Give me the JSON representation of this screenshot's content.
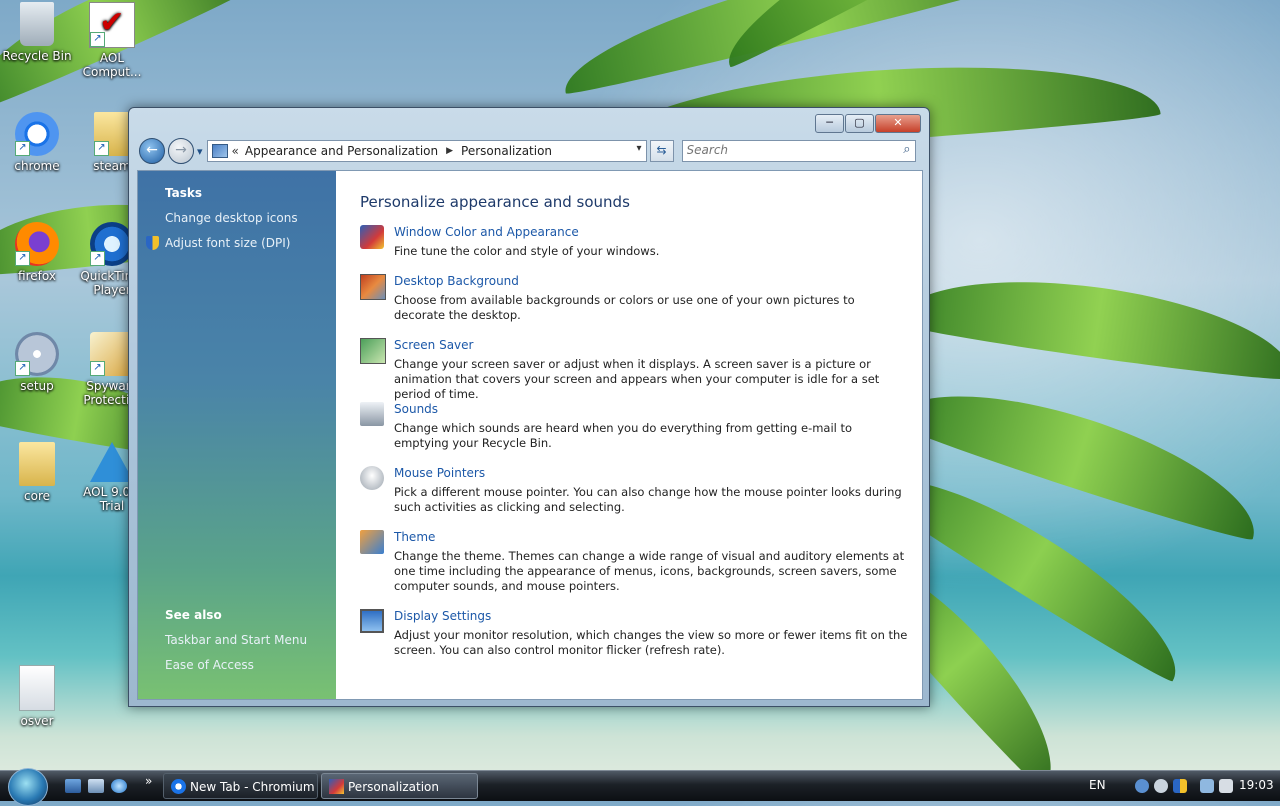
{
  "desktop": {
    "icons": [
      {
        "label": "Recycle Bin"
      },
      {
        "label": "AOL Comput..."
      },
      {
        "label": "chrome"
      },
      {
        "label": "steam"
      },
      {
        "label": "firefox"
      },
      {
        "label": "QuickTime Player"
      },
      {
        "label": "setup"
      },
      {
        "label": "Spyware Protecti..."
      },
      {
        "label": "core"
      },
      {
        "label": "AOL 9.0 F Trial"
      },
      {
        "label": "osver"
      }
    ]
  },
  "window": {
    "controls": {
      "minimize": "─",
      "maximize": "▢",
      "close": "✕"
    },
    "nav": {
      "back": "←",
      "forward": "→",
      "history": "▾"
    },
    "address": {
      "prefix": "«",
      "crumbs": [
        "Appearance and Personalization",
        "Personalization"
      ],
      "separator": "▶",
      "dropdown": "▾"
    },
    "refresh": "⇆",
    "search": {
      "placeholder": "Search",
      "icon": "⌕"
    },
    "sidebar": {
      "tasks_heading": "Tasks",
      "tasks": [
        "Change desktop icons",
        "Adjust font size (DPI)"
      ],
      "see_also_heading": "See also",
      "see_also": [
        "Taskbar and Start Menu",
        "Ease of Access"
      ]
    },
    "main": {
      "heading": "Personalize appearance and sounds",
      "items": [
        {
          "title": "Window Color and Appearance",
          "desc": "Fine tune the color and style of your windows."
        },
        {
          "title": "Desktop Background",
          "desc": "Choose from available backgrounds or colors or use one of your own pictures to decorate the desktop."
        },
        {
          "title": "Screen Saver",
          "desc": "Change your screen saver or adjust when it displays. A screen saver is a picture or animation that covers your screen and appears when your computer is idle for a set period of time."
        },
        {
          "title": "Sounds",
          "desc": "Change which sounds are heard when you do everything from getting e-mail to emptying your Recycle Bin."
        },
        {
          "title": "Mouse Pointers",
          "desc": "Pick a different mouse pointer. You can also change how the mouse pointer looks during such activities as clicking and selecting."
        },
        {
          "title": "Theme",
          "desc": "Change the theme. Themes can change a wide range of visual and auditory elements at one time including the appearance of menus, icons, backgrounds, screen savers, some computer sounds, and mouse pointers."
        },
        {
          "title": "Display Settings",
          "desc": "Adjust your monitor resolution, which changes the view so more or fewer items fit on the screen. You can also control monitor flicker (refresh rate)."
        }
      ]
    }
  },
  "taskbar": {
    "overflow": "»",
    "tasks": [
      {
        "label": "New Tab - Chromium"
      },
      {
        "label": "Personalization"
      }
    ],
    "language": "EN",
    "clock": "19:03"
  }
}
